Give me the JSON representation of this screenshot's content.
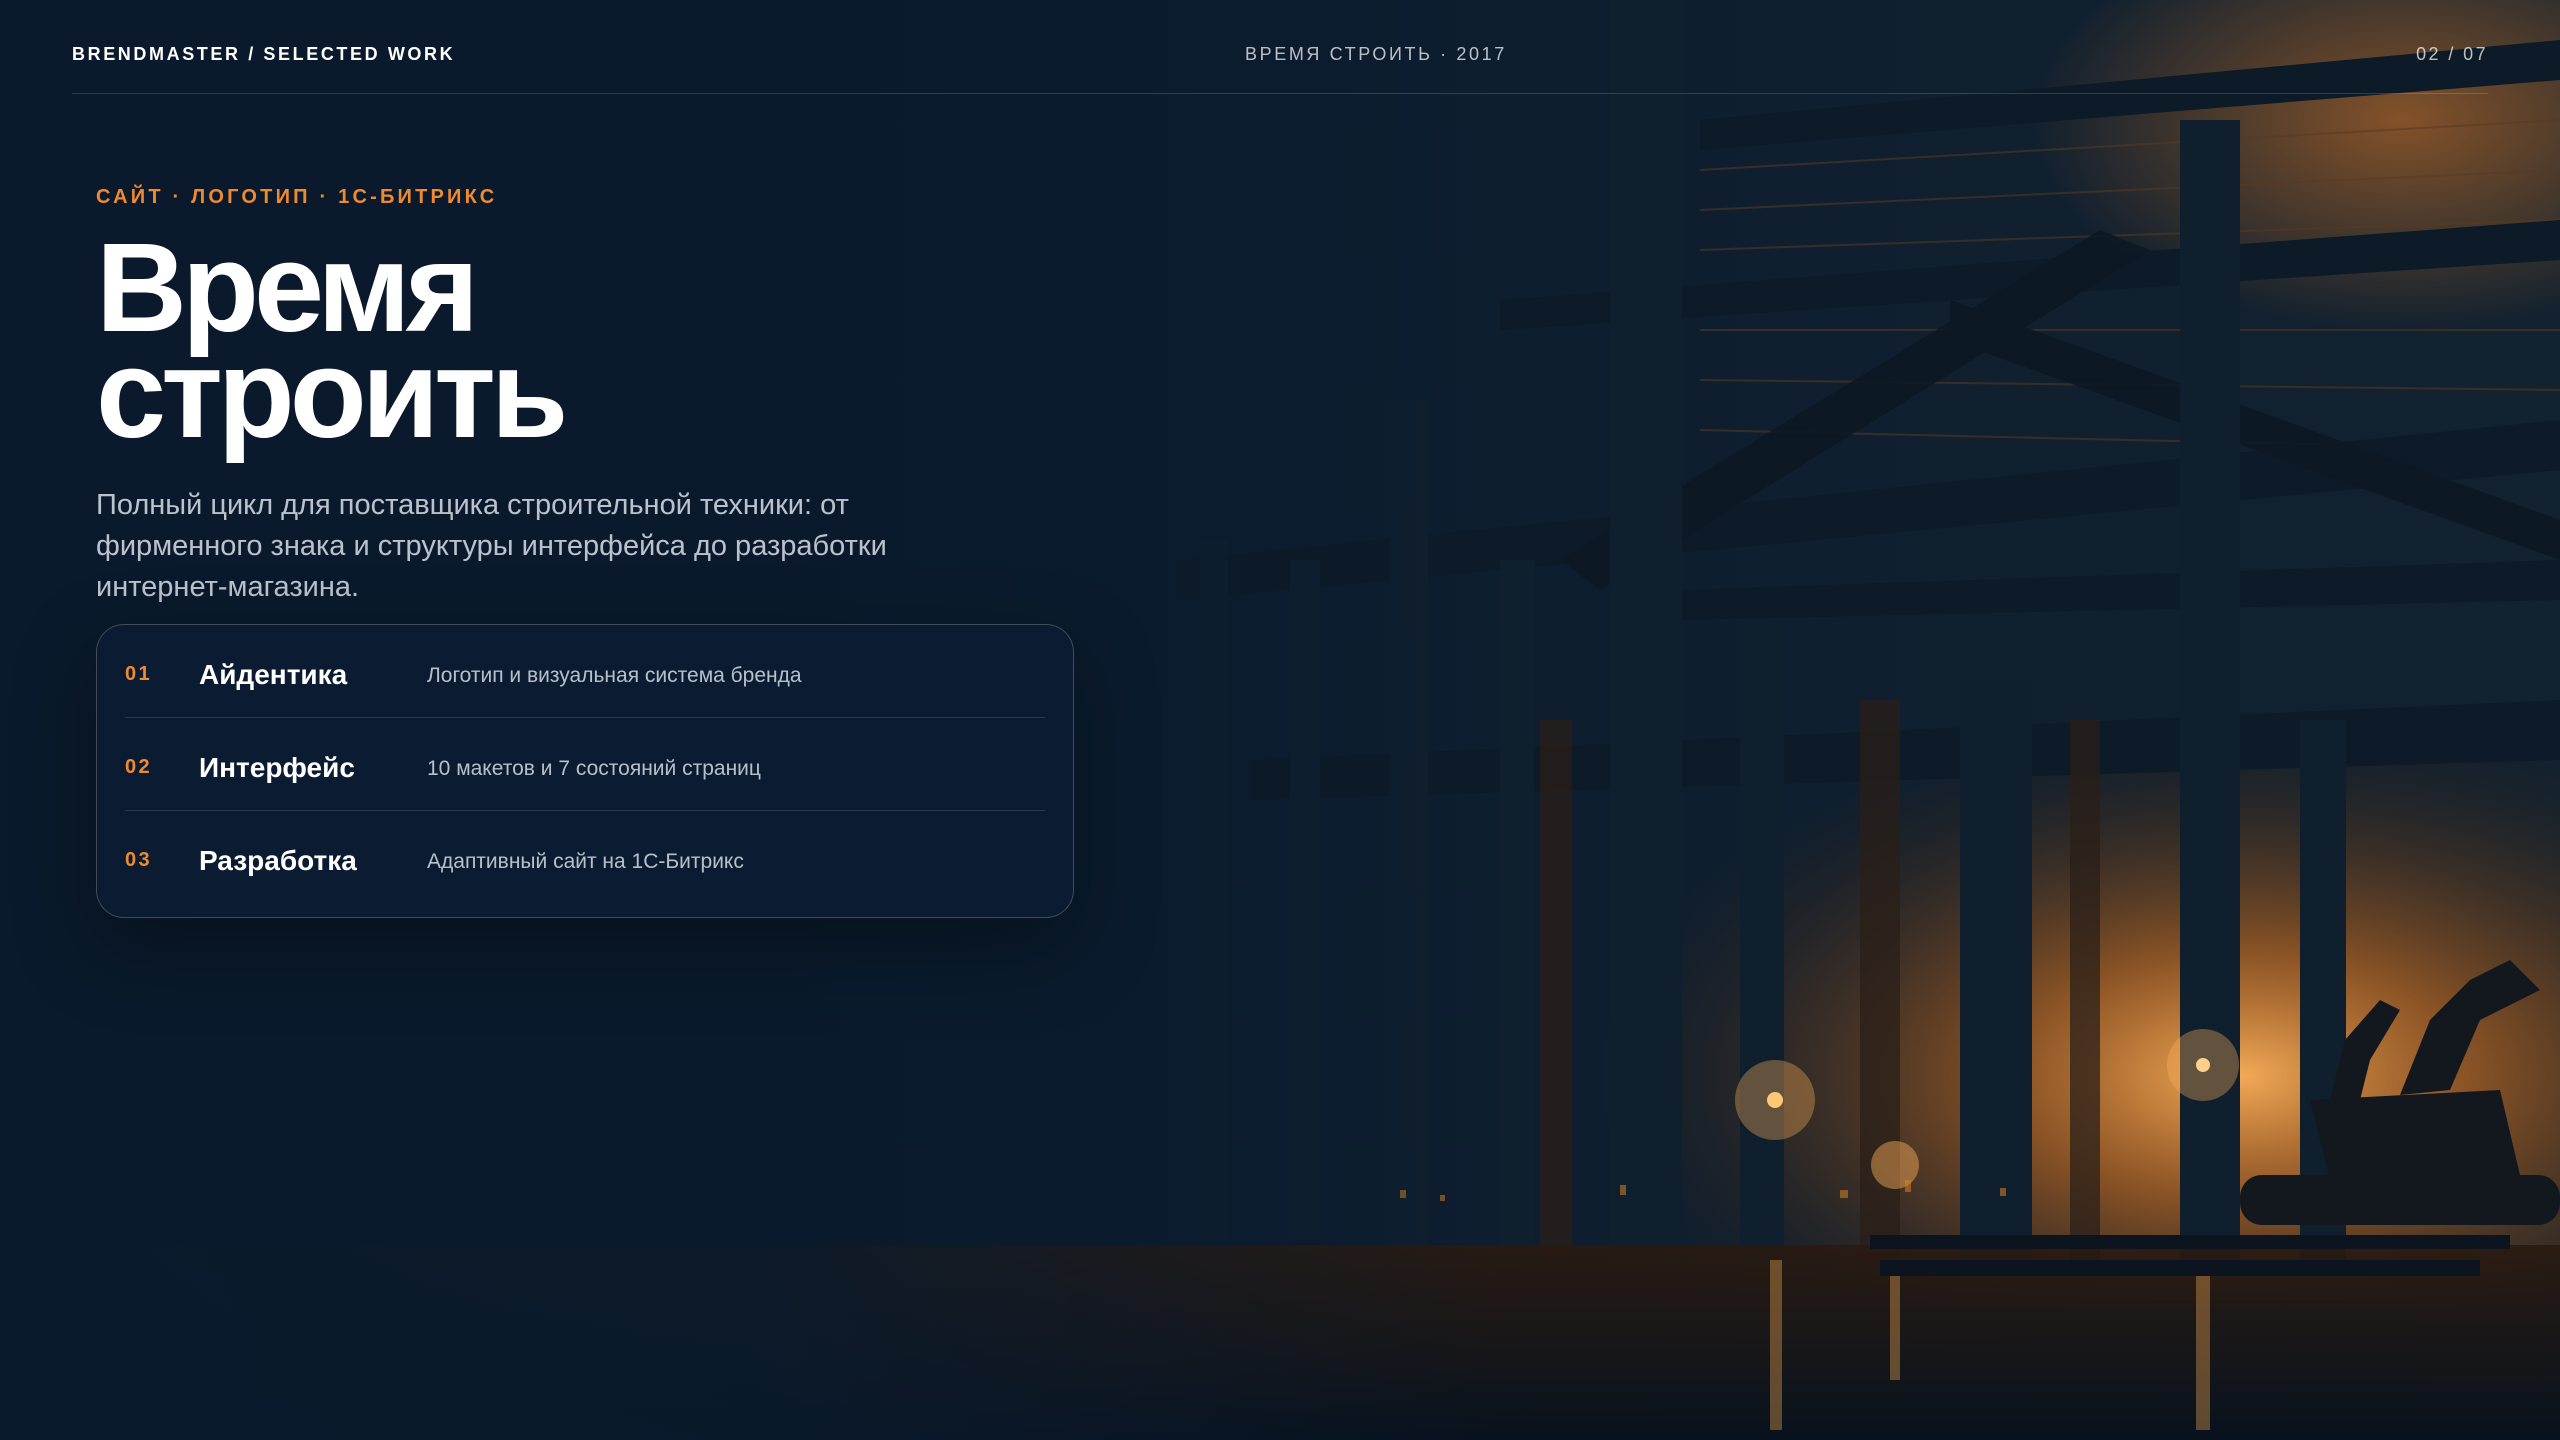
{
  "header": {
    "brand": "BRENDMASTER / SELECTED WORK",
    "project": "ВРЕМЯ СТРОИТЬ · 2017",
    "pager": "02 / 07"
  },
  "hero": {
    "tags": "САЙТ · ЛОГОТИП · 1С-БИТРИКС",
    "title_line1": "Время",
    "title_line2": "строить",
    "description": "Полный цикл для поставщика строительной техники: от фирменного знака и структуры интерфейса до разработки интернет-магазина."
  },
  "steps": [
    {
      "num": "01",
      "name": "Айдентика",
      "desc": "Логотип и визуальная система бренда"
    },
    {
      "num": "02",
      "name": "Интерфейс",
      "desc": "10 макетов и 7 состояний страниц"
    },
    {
      "num": "03",
      "name": "Разработка",
      "desc": "Адаптивный сайт на 1С-Битрикс"
    }
  ],
  "colors": {
    "background": "#0a1a2c",
    "accent": "#f08a2e",
    "glow": "#ffb25a"
  }
}
